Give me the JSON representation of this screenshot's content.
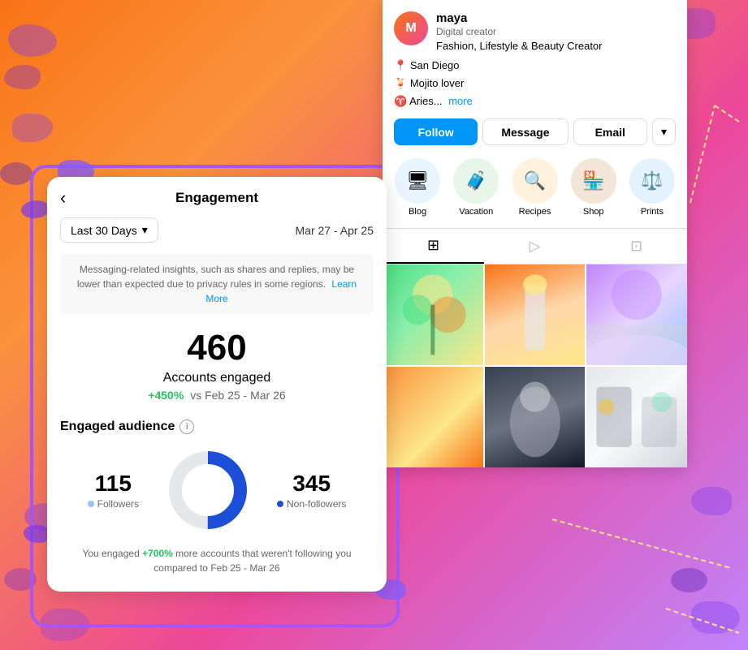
{
  "background": {
    "color_start": "#f97316",
    "color_end": "#c084fc"
  },
  "profile": {
    "name": "maya",
    "role": "Digital creator",
    "bio": "Fashion, Lifestyle & Beauty Creator",
    "location_icon": "📍",
    "location": "San Diego",
    "drink_icon": "🍹",
    "drink": "Mojito lover",
    "sign_icon": "♈",
    "sign": "Aries...",
    "more_label": "more",
    "avatar_initial": "M"
  },
  "action_buttons": {
    "follow": "Follow",
    "message": "Message",
    "email": "Email",
    "more_icon": "▾"
  },
  "highlights": [
    {
      "id": "blog",
      "label": "Blog",
      "icon": "🖥",
      "bg": "hl-blue"
    },
    {
      "id": "vacation",
      "label": "Vacation",
      "icon": "🧳",
      "bg": "hl-green"
    },
    {
      "id": "recipes",
      "label": "Recipes",
      "icon": "🔍",
      "bg": "hl-orange"
    },
    {
      "id": "shop",
      "label": "Shop",
      "icon": "🏪",
      "bg": "hl-brown"
    },
    {
      "id": "prints",
      "label": "Prints",
      "icon": "⚖",
      "bg": "hl-lightblue"
    }
  ],
  "view_toggle": {
    "grid_icon": "⊞",
    "reels_icon": "▷",
    "profile_icon": "⊡"
  },
  "engagement": {
    "title": "Engagement",
    "back_label": "‹",
    "date_filter": "Last 30 Days",
    "date_filter_icon": "▾",
    "date_range": "Mar 27 - Apr 25",
    "info_text": "Messaging-related insights, such as shares and replies, may be lower than expected due to privacy rules in some regions.",
    "learn_more": "Learn More",
    "big_number": "460",
    "big_label": "Accounts engaged",
    "growth_percent": "+450%",
    "growth_compare": "vs Feb 25 - Mar 26",
    "section_audience": "Engaged audience",
    "followers_count": "115",
    "followers_label": "Followers",
    "followers_color": "#93c5fd",
    "nonfollowers_count": "345",
    "nonfollowers_label": "Non-followers",
    "nonfollowers_color": "#1d4ed8",
    "donut_pct_followers": 25,
    "donut_pct_nonfollowers": 75,
    "growth_note_prefix": "You engaged ",
    "growth_note_percent": "+700%",
    "growth_note_suffix": " more accounts that weren't following you compared to Feb 25 - Mar 26"
  }
}
